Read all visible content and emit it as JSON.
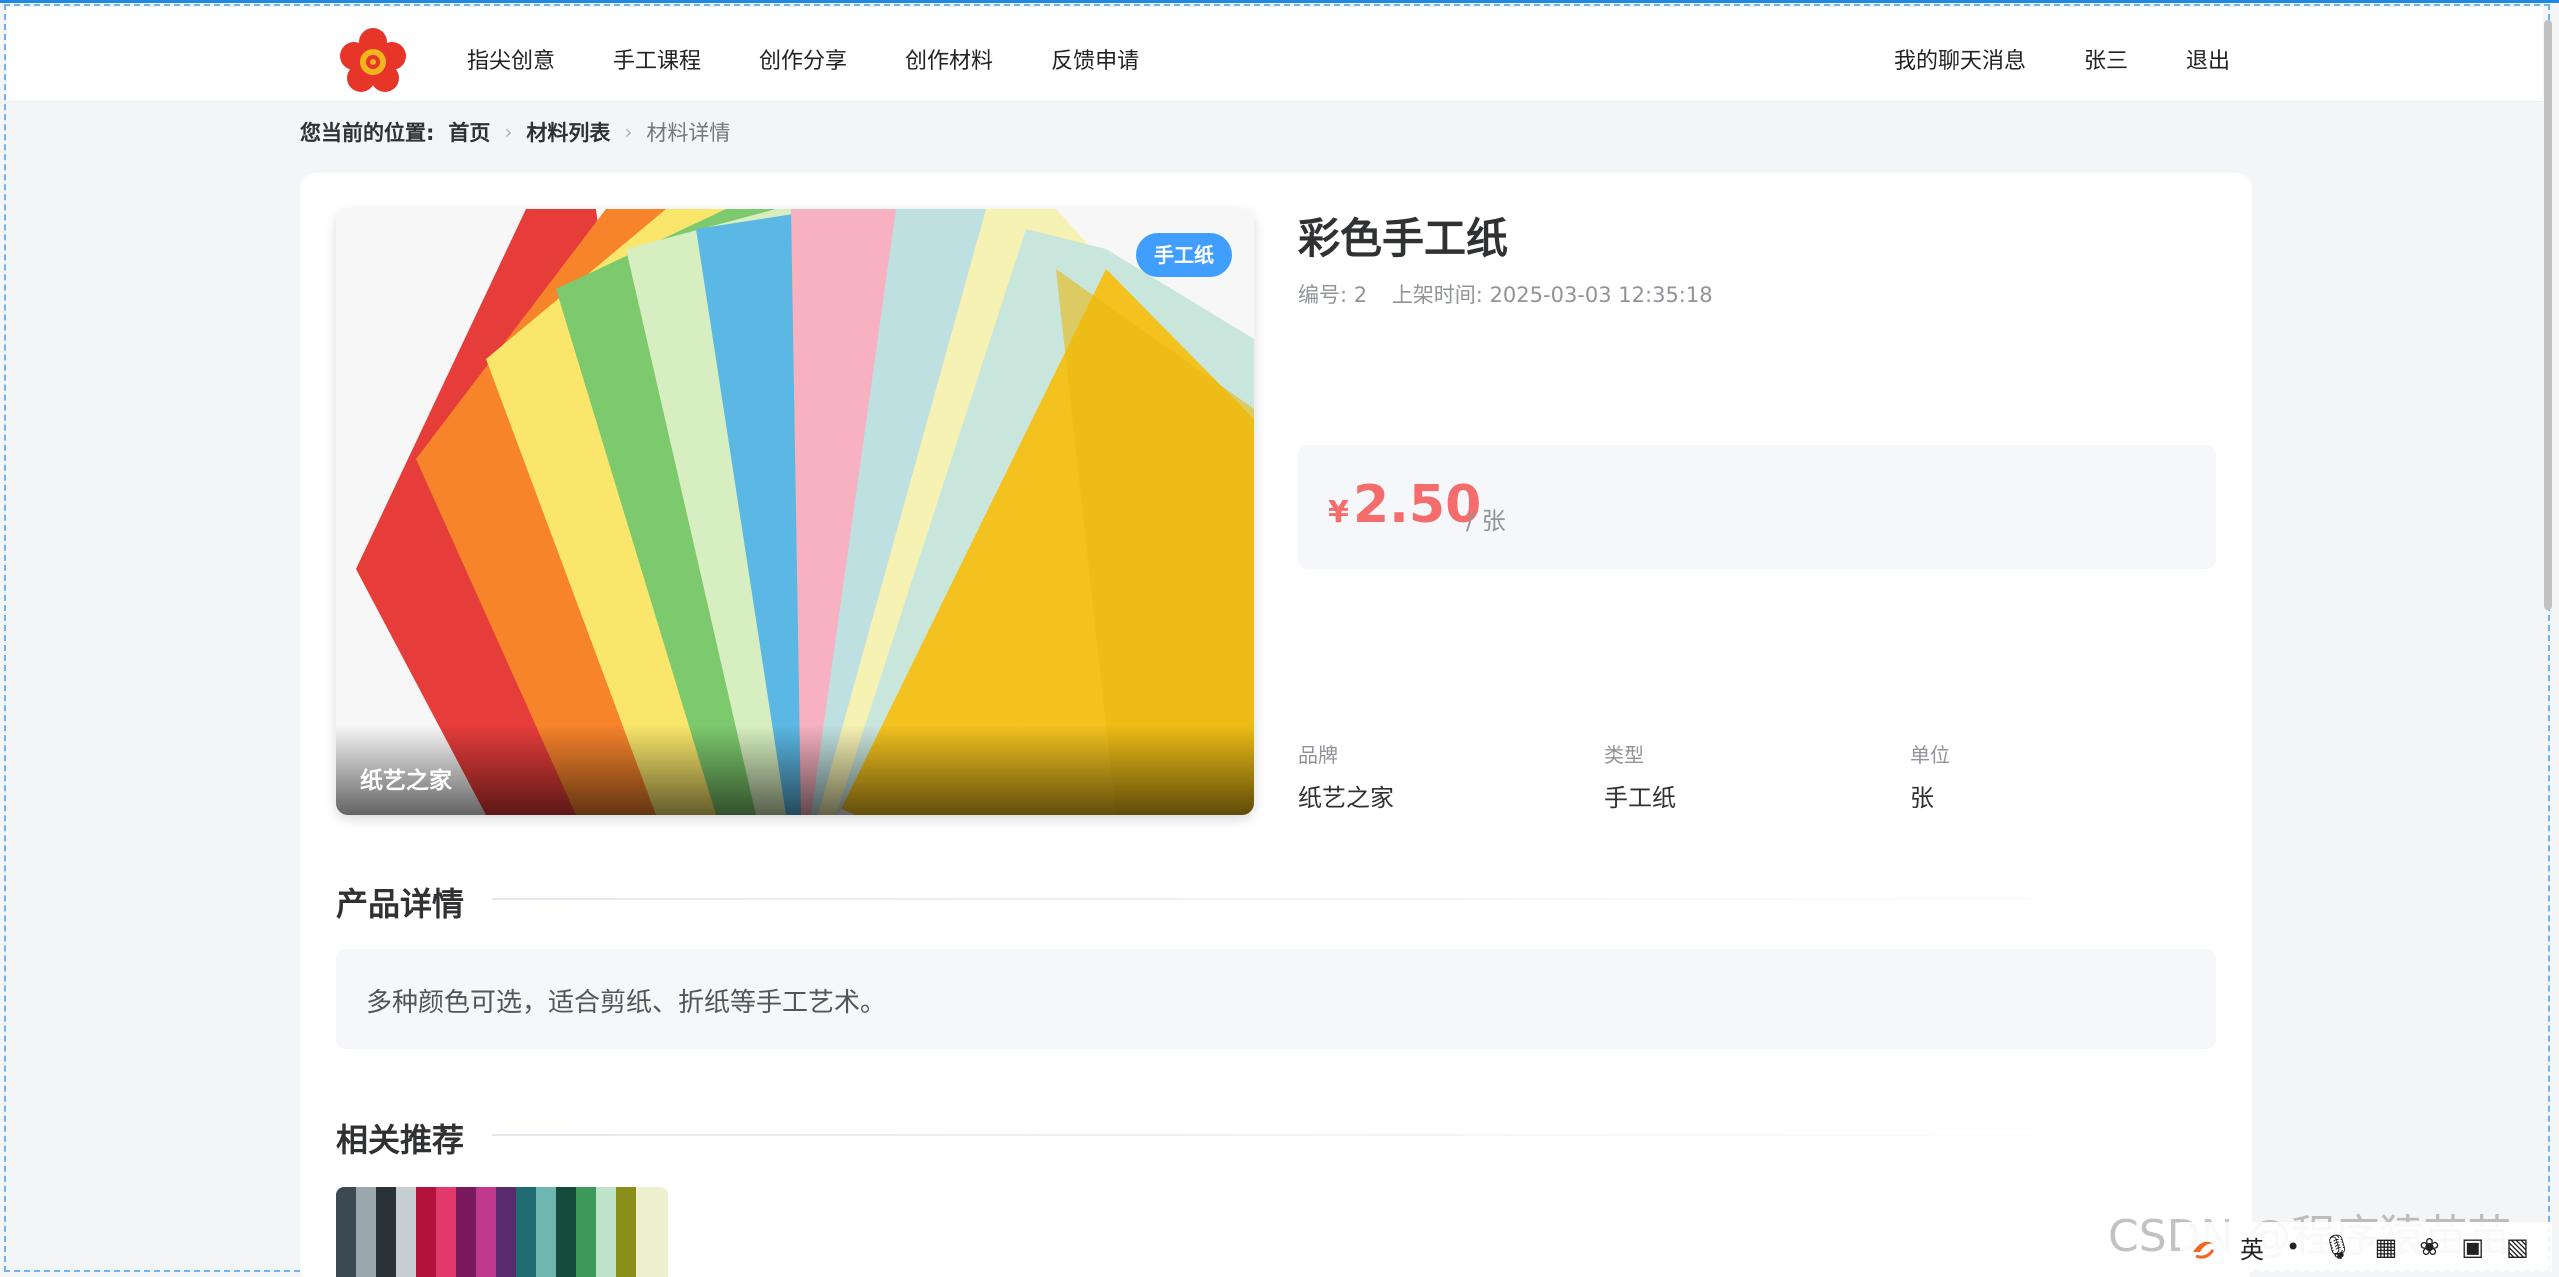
{
  "header": {
    "nav": [
      "指尖创意",
      "手工课程",
      "创作分享",
      "创作材料",
      "反馈申请"
    ],
    "right": [
      "我的聊天消息",
      "张三",
      "退出"
    ]
  },
  "breadcrumb": {
    "prefix": "您当前的位置:",
    "items": [
      "首页",
      "材料列表"
    ],
    "current": "材料详情"
  },
  "product": {
    "badge": "手工纸",
    "caption": "纸艺之家",
    "title": "彩色手工纸",
    "id_text": "编号: 2",
    "time_text": "上架时间: 2025-03-03 12:35:18",
    "currency": "¥",
    "price": "2.50",
    "price_unit": "/ 张",
    "attributes": [
      {
        "label": "品牌",
        "value": "纸艺之家"
      },
      {
        "label": "类型",
        "value": "手工纸"
      },
      {
        "label": "单位",
        "value": "张"
      }
    ]
  },
  "sections": {
    "detail_title": "产品详情",
    "detail_text": "多种颜色可选，适合剪纸、折纸等手工艺术。",
    "recommend_title": "相关推荐"
  },
  "ime": {
    "lang": "英",
    "watermark": "CSDN @程序猿苗苗"
  },
  "colors": {
    "accent": "#409eff",
    "price": "#f56c6c"
  }
}
